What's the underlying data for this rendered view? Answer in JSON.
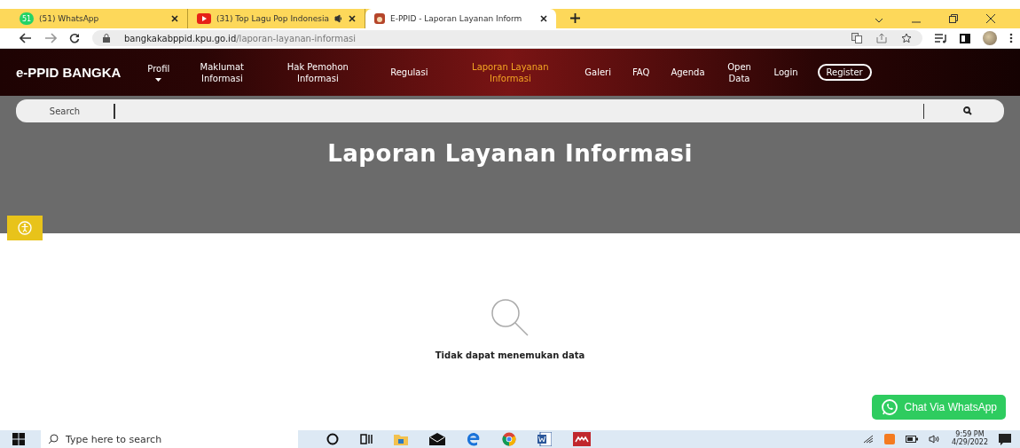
{
  "browser": {
    "tabs": [
      {
        "title": "(51) WhatsApp",
        "kind": "whatsapp",
        "badge": "51",
        "selected": false,
        "audio": false
      },
      {
        "title": "(31) Top Lagu Pop Indonesia",
        "kind": "youtube",
        "selected": false,
        "audio": true
      },
      {
        "title": "E-PPID - Laporan Layanan Inform",
        "kind": "site",
        "selected": true,
        "audio": false
      }
    ],
    "address": {
      "host": "bangkakabppid.kpu.go.id",
      "path": "/laporan-layanan-informasi"
    }
  },
  "site": {
    "brand": "e-PPID BANGKA",
    "nav": [
      {
        "label": "Profil",
        "dropdown": true,
        "selected": false
      },
      {
        "label": "Maklumat Informasi",
        "dropdown": false,
        "selected": false
      },
      {
        "label": "Hak Pemohon Informasi",
        "dropdown": false,
        "selected": false
      },
      {
        "label": "Regulasi",
        "dropdown": false,
        "selected": false
      },
      {
        "label": "Laporan Layanan Informasi",
        "dropdown": false,
        "selected": true
      },
      {
        "label": "Galeri",
        "dropdown": false,
        "selected": false
      },
      {
        "label": "FAQ",
        "dropdown": false,
        "selected": false
      },
      {
        "label": "Agenda",
        "dropdown": false,
        "selected": false
      },
      {
        "label": "Open Data",
        "dropdown": false,
        "selected": false
      },
      {
        "label": "Login",
        "dropdown": false,
        "selected": false
      }
    ],
    "register": "Register",
    "search": {
      "label": "Search"
    },
    "hero_title": "Laporan Layanan Informasi",
    "empty_message": "Tidak dapat menemukan data",
    "whatsapp_button": "Chat Via WhatsApp"
  },
  "taskbar": {
    "search_placeholder": "Type here to search",
    "time": "9:59 PM",
    "date": "4/29/2022"
  }
}
